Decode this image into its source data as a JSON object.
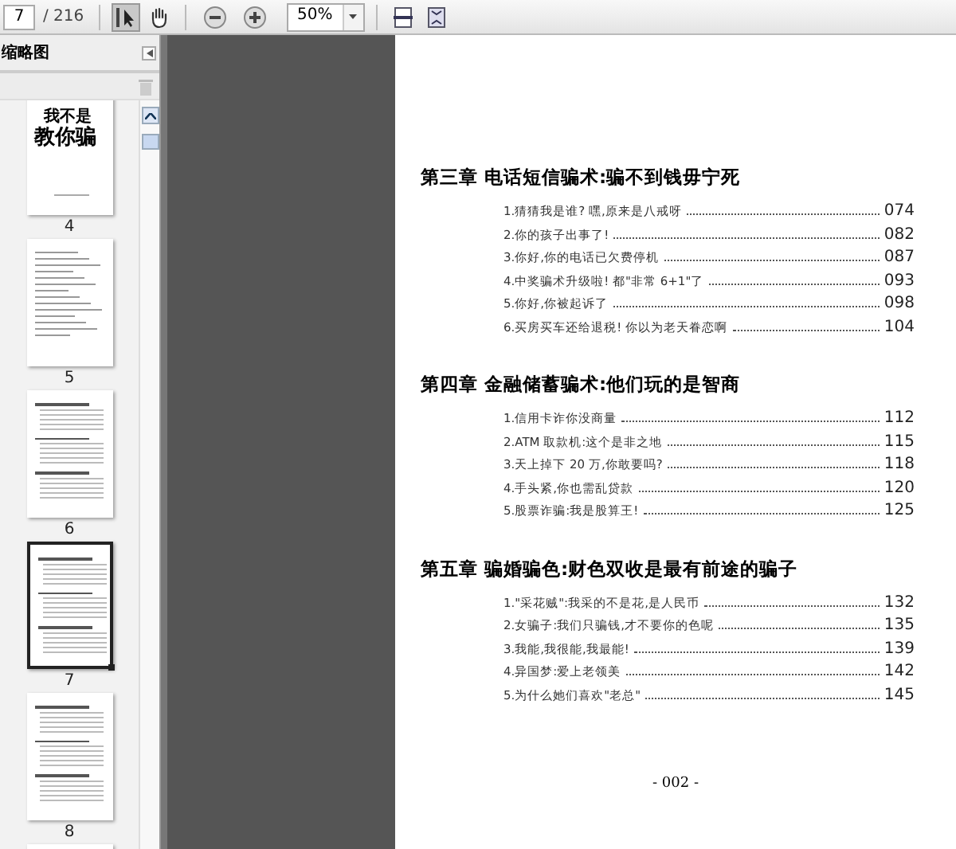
{
  "toolbar": {
    "page_number": "7",
    "page_count": "/ 216",
    "tools": [
      {
        "kind": "select",
        "selected": true
      },
      {
        "kind": "hand",
        "selected": false
      }
    ],
    "zoom": "50%"
  },
  "sidebar": {
    "title": "缩略图",
    "thumbnails": [
      {
        "kind": "cover",
        "label": "4",
        "selected": false,
        "cover_title": [
          "我不是",
          "教你骗"
        ]
      },
      {
        "kind": "text",
        "label": "5",
        "selected": false
      },
      {
        "kind": "toc",
        "label": "6",
        "selected": false
      },
      {
        "kind": "toc",
        "label": "7",
        "selected": true
      },
      {
        "kind": "toc",
        "label": "8",
        "selected": false
      },
      {
        "kind": "text",
        "selected": false
      }
    ]
  },
  "page": {
    "chapters": [
      {
        "title": "第三章 电话短信骗术:骗不到钱毋宁死",
        "items": [
          {
            "text": "1.猜猜我是谁? 嘿,原来是八戒呀",
            "page": "074"
          },
          {
            "text": "2.你的孩子出事了!",
            "page": "082"
          },
          {
            "text": "3.你好,你的电话已欠费停机",
            "page": "087"
          },
          {
            "text": "4.中奖骗术升级啦! 都\"非常 6+1\"了",
            "page": "093"
          },
          {
            "text": "5.你好,你被起诉了",
            "page": "098"
          },
          {
            "text": "6.买房买车还给退税! 你以为老天眷恋啊",
            "page": "104"
          }
        ]
      },
      {
        "title": "第四章 金融储蓄骗术:他们玩的是智商",
        "items": [
          {
            "text": "1.信用卡诈你没商量",
            "page": "112"
          },
          {
            "text": "2.ATM 取款机:这个是非之地",
            "page": "115"
          },
          {
            "text": "3.天上掉下 20 万,你敢要吗?",
            "page": "118"
          },
          {
            "text": "4.手头紧,你也需乱贷款",
            "page": "120"
          },
          {
            "text": "5.股票诈骗:我是股算王!",
            "page": "125"
          }
        ]
      },
      {
        "title": "第五章 骗婚骗色:财色双收是最有前途的骗子",
        "items": [
          {
            "text": "1.\"采花贼\":我采的不是花,是人民币",
            "page": "132"
          },
          {
            "text": "2.女骗子:我们只骗钱,才不要你的色呢",
            "page": "135"
          },
          {
            "text": "3.我能,我很能,我最能!",
            "page": "139"
          },
          {
            "text": "4.异国梦:爱上老领美",
            "page": "142"
          },
          {
            "text": "5.为什么她们喜欢\"老总\"",
            "page": "145"
          }
        ]
      }
    ],
    "folio": "- 002 -"
  }
}
